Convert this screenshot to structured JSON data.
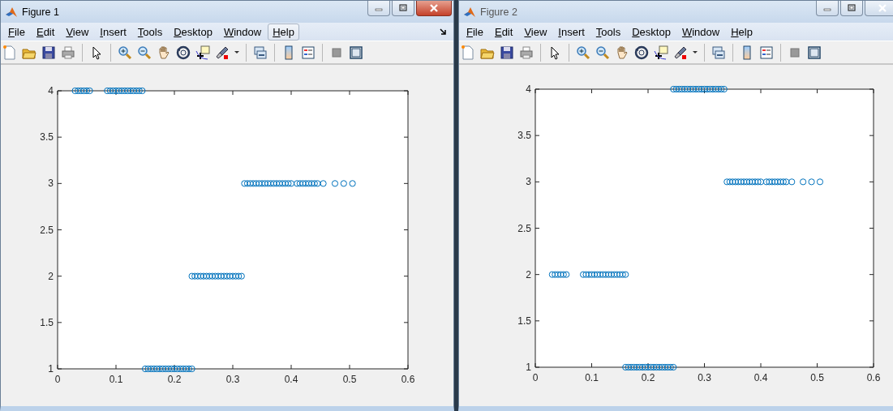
{
  "windows": [
    {
      "title": "Figure 1",
      "active": true,
      "menu": [
        {
          "label": "File",
          "highlighted": false
        },
        {
          "label": "Edit",
          "highlighted": false
        },
        {
          "label": "View",
          "highlighted": false
        },
        {
          "label": "Insert",
          "highlighted": false
        },
        {
          "label": "Tools",
          "highlighted": false
        },
        {
          "label": "Desktop",
          "highlighted": false
        },
        {
          "label": "Window",
          "highlighted": false
        },
        {
          "label": "Help",
          "highlighted": true
        }
      ],
      "chart_data": {
        "type": "scatter",
        "xlim": [
          0,
          0.6
        ],
        "ylim": [
          1,
          4
        ],
        "xticks": [
          0,
          0.1,
          0.2,
          0.3,
          0.4,
          0.5,
          0.6
        ],
        "yticks": [
          1,
          1.5,
          2,
          2.5,
          3,
          3.5,
          4
        ],
        "x": [
          0.03,
          0.035,
          0.04,
          0.045,
          0.05,
          0.055,
          0.085,
          0.09,
          0.095,
          0.1,
          0.105,
          0.11,
          0.115,
          0.12,
          0.125,
          0.13,
          0.135,
          0.14,
          0.145,
          0.32,
          0.325,
          0.33,
          0.335,
          0.34,
          0.345,
          0.35,
          0.355,
          0.36,
          0.365,
          0.37,
          0.375,
          0.38,
          0.385,
          0.39,
          0.395,
          0.4,
          0.41,
          0.415,
          0.42,
          0.425,
          0.43,
          0.435,
          0.44,
          0.445,
          0.455,
          0.475,
          0.49,
          0.505,
          0.23,
          0.235,
          0.24,
          0.245,
          0.25,
          0.255,
          0.26,
          0.265,
          0.27,
          0.275,
          0.28,
          0.285,
          0.29,
          0.295,
          0.3,
          0.305,
          0.31,
          0.315,
          0.15,
          0.155,
          0.16,
          0.165,
          0.17,
          0.175,
          0.18,
          0.185,
          0.19,
          0.195,
          0.2,
          0.205,
          0.21,
          0.215,
          0.22,
          0.225,
          0.23
        ],
        "series": [
          {
            "color": "#0072bd",
            "values": [
              4,
              4,
              4,
              4,
              4,
              4,
              4,
              4,
              4,
              4,
              4,
              4,
              4,
              4,
              4,
              4,
              4,
              4,
              4,
              3,
              3,
              3,
              3,
              3,
              3,
              3,
              3,
              3,
              3,
              3,
              3,
              3,
              3,
              3,
              3,
              3,
              3,
              3,
              3,
              3,
              3,
              3,
              3,
              3,
              3,
              3,
              3,
              3,
              2,
              2,
              2,
              2,
              2,
              2,
              2,
              2,
              2,
              2,
              2,
              2,
              2,
              2,
              2,
              2,
              2,
              2,
              1,
              1,
              1,
              1,
              1,
              1,
              1,
              1,
              1,
              1,
              1,
              1,
              1,
              1,
              1,
              1,
              1
            ]
          }
        ]
      }
    },
    {
      "title": "Figure 2",
      "active": false,
      "menu": [
        {
          "label": "File",
          "highlighted": false
        },
        {
          "label": "Edit",
          "highlighted": false
        },
        {
          "label": "View",
          "highlighted": false
        },
        {
          "label": "Insert",
          "highlighted": false
        },
        {
          "label": "Tools",
          "highlighted": false
        },
        {
          "label": "Desktop",
          "highlighted": false
        },
        {
          "label": "Window",
          "highlighted": false
        },
        {
          "label": "Help",
          "highlighted": false
        }
      ],
      "chart_data": {
        "type": "scatter",
        "xlim": [
          0,
          0.6
        ],
        "ylim": [
          1,
          4
        ],
        "xticks": [
          0,
          0.1,
          0.2,
          0.3,
          0.4,
          0.5,
          0.6
        ],
        "yticks": [
          1,
          1.5,
          2,
          2.5,
          3,
          3.5,
          4
        ],
        "x": [
          0.245,
          0.25,
          0.255,
          0.26,
          0.265,
          0.27,
          0.275,
          0.28,
          0.285,
          0.29,
          0.295,
          0.3,
          0.305,
          0.31,
          0.315,
          0.32,
          0.325,
          0.33,
          0.335,
          0.34,
          0.345,
          0.35,
          0.355,
          0.36,
          0.365,
          0.37,
          0.375,
          0.38,
          0.385,
          0.39,
          0.395,
          0.4,
          0.41,
          0.415,
          0.42,
          0.425,
          0.43,
          0.435,
          0.44,
          0.445,
          0.455,
          0.475,
          0.49,
          0.505,
          0.03,
          0.035,
          0.04,
          0.045,
          0.05,
          0.055,
          0.085,
          0.09,
          0.095,
          0.1,
          0.105,
          0.11,
          0.115,
          0.12,
          0.125,
          0.13,
          0.135,
          0.14,
          0.145,
          0.15,
          0.155,
          0.16,
          0.16,
          0.165,
          0.17,
          0.175,
          0.18,
          0.185,
          0.19,
          0.195,
          0.2,
          0.205,
          0.21,
          0.215,
          0.22,
          0.225,
          0.23,
          0.235,
          0.24,
          0.245
        ],
        "series": [
          {
            "color": "#0072bd",
            "values": [
              4,
              4,
              4,
              4,
              4,
              4,
              4,
              4,
              4,
              4,
              4,
              4,
              4,
              4,
              4,
              4,
              4,
              4,
              4,
              3,
              3,
              3,
              3,
              3,
              3,
              3,
              3,
              3,
              3,
              3,
              3,
              3,
              3,
              3,
              3,
              3,
              3,
              3,
              3,
              3,
              3,
              3,
              3,
              3,
              2,
              2,
              2,
              2,
              2,
              2,
              2,
              2,
              2,
              2,
              2,
              2,
              2,
              2,
              2,
              2,
              2,
              2,
              2,
              2,
              2,
              2,
              1,
              1,
              1,
              1,
              1,
              1,
              1,
              1,
              1,
              1,
              1,
              1,
              1,
              1,
              1,
              1,
              1,
              1
            ]
          }
        ]
      }
    }
  ]
}
